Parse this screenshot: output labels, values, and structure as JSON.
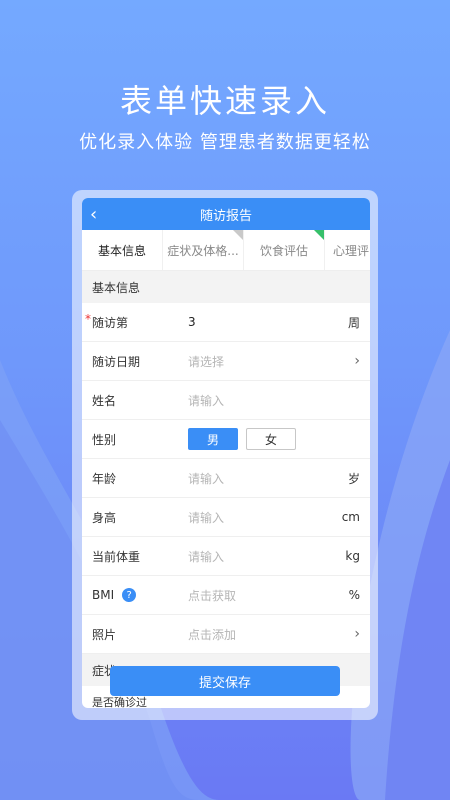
{
  "hero": {
    "title": "表单快速录入",
    "subtitle": "优化录入体验 管理患者数据更轻松"
  },
  "nav": {
    "back": "‹",
    "title": "随访报告"
  },
  "tabs": [
    {
      "label": "基本信息",
      "active": true
    },
    {
      "label": "症状及体格..."
    },
    {
      "label": "饮食评估"
    },
    {
      "label": "心理评"
    }
  ],
  "sections": {
    "basic": "基本信息",
    "symptom": "症状"
  },
  "rows": {
    "visit": {
      "label": "随访第",
      "value": "3",
      "unit": "周"
    },
    "date": {
      "label": "随访日期",
      "placeholder": "请选择"
    },
    "name": {
      "label": "姓名",
      "placeholder": "请输入"
    },
    "gender": {
      "label": "性别",
      "options": [
        "男",
        "女"
      ]
    },
    "age": {
      "label": "年龄",
      "placeholder": "请输入",
      "unit": "岁"
    },
    "height": {
      "label": "身高",
      "placeholder": "请输入",
      "unit": "cm"
    },
    "weight": {
      "label": "当前体重",
      "placeholder": "请输入",
      "unit": "kg"
    },
    "bmi": {
      "label": "BMI",
      "help": "?",
      "placeholder": "点击获取",
      "unit": "%"
    },
    "photo": {
      "label": "照片",
      "placeholder": "点击添加"
    }
  },
  "required_mark": "*",
  "submit": "提交保存",
  "next_row": "是否确诊过",
  "colors": {
    "primary": "#3a8ef6",
    "green": "#36c06a"
  }
}
